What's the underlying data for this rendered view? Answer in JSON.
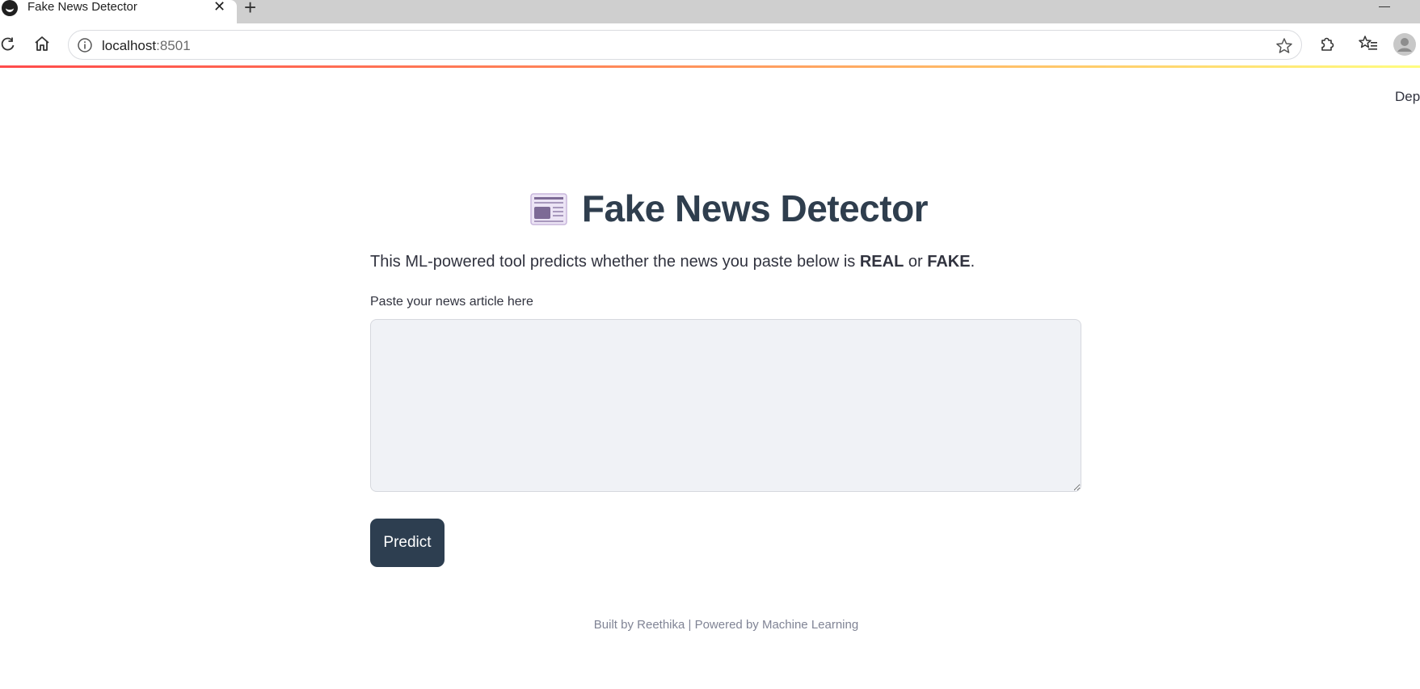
{
  "browser": {
    "tab_title": "Fake News Detector",
    "url_host": "localhost",
    "url_port": ":8501"
  },
  "page": {
    "deploy_label": "Dep",
    "title": "Fake News Detector",
    "intro_prefix": "This ML-powered tool predicts whether the news you paste below is ",
    "intro_real": "REAL",
    "intro_or": " or ",
    "intro_fake": "FAKE",
    "intro_suffix": ".",
    "input_label": "Paste your news article here",
    "input_value": "",
    "predict_label": "Predict",
    "footer": "Built by Reethika | Powered by Machine Learning"
  },
  "colors": {
    "primary_button": "#2d3e50",
    "heading": "#2f3e4e",
    "textarea_bg": "#f0f2f6",
    "footer_text": "#808495"
  }
}
